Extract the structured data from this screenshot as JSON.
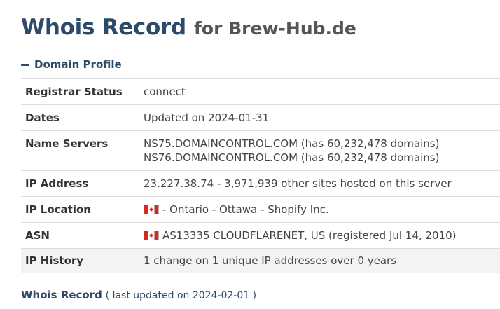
{
  "header": {
    "title": "Whois Record",
    "for_text": "for Brew-Hub.de"
  },
  "section": {
    "label": "Domain Profile",
    "icon": "minus-icon"
  },
  "profile": {
    "registrar_status": {
      "label": "Registrar Status",
      "value": "connect"
    },
    "dates": {
      "label": "Dates",
      "value": "Updated on 2024-01-31"
    },
    "name_servers": {
      "label": "Name Servers",
      "values": [
        "NS75.DOMAINCONTROL.COM (has 60,232,478 domains)",
        "NS76.DOMAINCONTROL.COM (has 60,232,478 domains)"
      ]
    },
    "ip_address": {
      "label": "IP Address",
      "value": "23.227.38.74 - 3,971,939 other sites hosted on this server"
    },
    "ip_location": {
      "label": "IP Location",
      "value": "- Ontario - Ottawa - Shopify Inc.",
      "flag": "canada-flag-icon"
    },
    "asn": {
      "label": "ASN",
      "value": "AS13335 CLOUDFLARENET, US (registered Jul 14, 2010)",
      "flag": "canada-flag-icon"
    },
    "ip_history": {
      "label": "IP History",
      "value": "1 change on 1 unique IP addresses over 0 years"
    }
  },
  "footer": {
    "title": "Whois Record",
    "updated": "( last updated on 2024-02-01 )"
  },
  "colors": {
    "heading": "#2e4a6b",
    "border": "#dcdcdc",
    "row_alt": "#f3f3f3"
  }
}
